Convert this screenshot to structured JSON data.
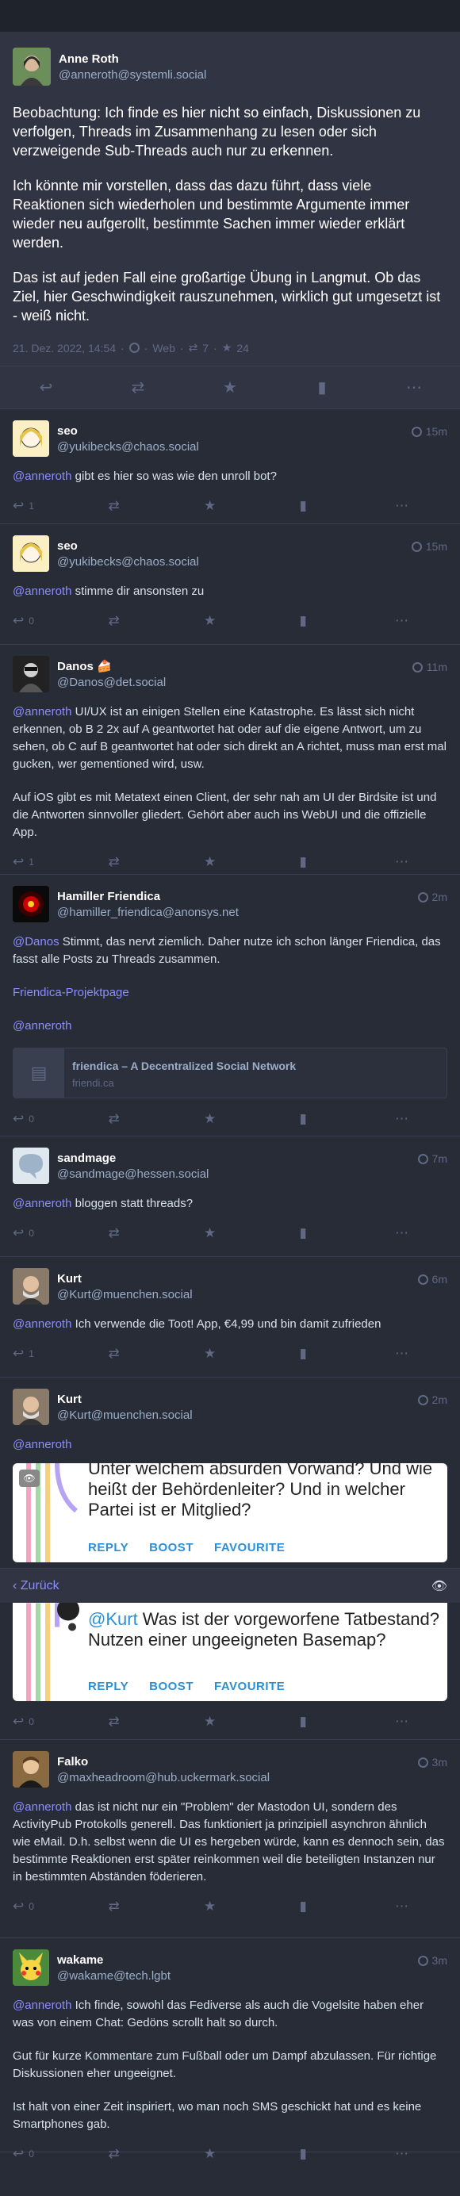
{
  "main": {
    "display_name": "Anne Roth",
    "acct": "@anneroth@systemli.social",
    "paragraphs": [
      "Beobachtung: Ich finde es hier nicht so einfach, Diskussionen zu verfolgen, Threads im Zusammenhang zu lesen oder sich verzweigende Sub-Threads auch nur zu erkennen.",
      "Ich könnte mir vorstellen, dass das dazu führt, dass viele Reaktionen sich wiederholen und bestimmte Argumente immer wieder neu aufgerollt, bestimmte Sachen immer wieder erklärt werden.",
      "Das ist auf jeden Fall eine großartige Übung in Langmut. Ob das Ziel, hier Geschwindigkeit rauszunehmen, wirklich gut umgesetzt ist - weiß nicht."
    ],
    "date": "21. Dez. 2022, 14:54",
    "source": "Web",
    "boosts": "7",
    "favourites": "24"
  },
  "replies": [
    {
      "name": "seo",
      "acct": "@yukibecks@chaos.social",
      "time": "15m",
      "text_mention": "@anneroth",
      "text": " gibt es hier so was wie den unroll bot?",
      "replies_count": "1"
    },
    {
      "name": "seo",
      "acct": "@yukibecks@chaos.social",
      "time": "15m",
      "text_mention": "@anneroth",
      "text": " stimme dir ansonsten zu",
      "replies_count": "0"
    },
    {
      "name": "Danos 🍰",
      "acct": "@Danos@det.social",
      "time": "11m",
      "p1_mention": "@anneroth",
      "p1": " UI/UX ist an einigen Stellen eine Katastrophe. Es lässt sich nicht erkennen, ob B 2 2x auf A geantwortet hat oder auf die eigene Antwort, um zu sehen, ob C auf B geantwortet hat oder sich direkt an A richtet, muss man erst mal gucken, wer gementioned wird, usw.",
      "p2": "Auf iOS gibt es mit Metatext einen Client, der sehr nah am UI der Birdsite ist und die Antworten sinnvoller gliedert. Gehört aber auch ins WebUI und die offizielle App.",
      "replies_count": "1"
    },
    {
      "name": "Hamiller Friendica",
      "acct": "@hamiller_friendica@anonsys.net",
      "time": "2m",
      "p1_mention": "@Danos",
      "p1": " Stimmt, das nervt ziemlich. Daher nutze ich schon länger Friendica, das fasst alle Posts zu Threads zusammen.",
      "link": "Friendica-Projektpage",
      "mention2": "@anneroth",
      "card_title": "friendica – A Decentralized Social Network",
      "card_host": "friendi.ca",
      "replies_count": "0"
    },
    {
      "name": "sandmage",
      "acct": "@sandmage@hessen.social",
      "time": "7m",
      "text_mention": "@anneroth",
      "text": " bloggen statt threads?",
      "replies_count": "0"
    },
    {
      "name": "Kurt",
      "acct": "@Kurt@muenchen.social",
      "time": "6m",
      "text_mention": "@anneroth",
      "text": " Ich verwende die Toot! App, €4,99 und bin damit zufrieden",
      "replies_count": "1"
    },
    {
      "name": "Kurt",
      "acct": "@Kurt@muenchen.social",
      "time": "2m",
      "text_mention": "@anneroth",
      "text": "",
      "embed_text": "Unter welchem absurden Vorwand? Und wie heißt der Behördenleiter? Und in welcher Partei ist er Mitglied?",
      "embed2_mention": "@Kurt",
      "embed2_text": " Was ist der vorgeworfene Tatbestand? Nutzen einer ungeeigneten Basemap?",
      "replies_count": "0"
    },
    {
      "name": "Falko",
      "acct": "@maxheadroom@hub.uckermark.social",
      "time": "3m",
      "p1_mention": "@anneroth",
      "p1": " das ist nicht nur ein \"Problem\" der Mastodon UI, sondern des ActivityPub Protokolls generell. Das funktioniert ja prinzipiell asynchron ähnlich wie eMail. D.h. selbst wenn die UI es hergeben würde, kann es dennoch sein, das bestimmte Reaktionen erst später reinkommen weil die beteiligten Instanzen nur in bestimmten Abständen föderieren.",
      "replies_count": "0"
    },
    {
      "name": "wakame",
      "acct": "@wakame@tech.lgbt",
      "time": "3m",
      "p1_mention": "@anneroth",
      "p1": " Ich finde, sowohl das Fediverse als auch die Vogelsite haben eher was von einem Chat: Gedöns scrollt halt so durch.",
      "p2": "Gut für kurze Kommentare zum Fußball oder um Dampf abzulassen. Für richtige Diskussionen eher ungeeignet.",
      "p3": "Ist halt von einer Zeit inspiriert, wo man noch SMS geschickt hat und es keine Smartphones gab.",
      "replies_count": "0"
    }
  ],
  "embed_buttons": {
    "reply": "REPLY",
    "boost": "BOOST",
    "favourite": "FAVOURITE"
  },
  "back_bar": {
    "label": "Zurück"
  },
  "colors": {
    "bg": "#282c37",
    "accent": "#8c8dff",
    "muted": "#606984"
  }
}
